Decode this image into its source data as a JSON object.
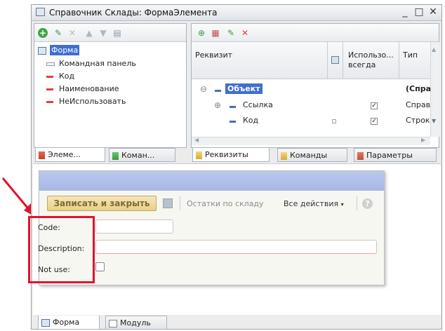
{
  "window": {
    "title": "Справочник Склады: ФормаЭлемента"
  },
  "left_panel": {
    "tree": [
      {
        "label": "Форма",
        "selected": true
      },
      {
        "label": "Командная панель"
      },
      {
        "label": "Код"
      },
      {
        "label": "Наименование"
      },
      {
        "label": "НеИспользовать"
      }
    ],
    "tabs": [
      "Элеме...",
      "Коман..."
    ]
  },
  "right_panel": {
    "columns": {
      "attr": "Реквизит",
      "always": "Использо... всегда",
      "type": "Тип"
    },
    "rows": [
      {
        "name": "Объект",
        "type": "(Спра",
        "checked": false,
        "expander": "⊖"
      },
      {
        "name": "Ссылка",
        "type": "Справ",
        "checked": true,
        "expander": "⊕"
      },
      {
        "name": "Код",
        "type": "Строк",
        "checked": true,
        "expander": ""
      }
    ],
    "tabs": [
      "Реквизиты",
      "Команды",
      "Параметры"
    ]
  },
  "preview": {
    "save_close": "Записать и закрыть",
    "stock_link": "Остатки по складу",
    "all_actions": "Все действия",
    "fields": [
      {
        "label": "Code:",
        "value": ""
      },
      {
        "label": "Description:",
        "value": ""
      },
      {
        "label": "Not use:",
        "checked": false
      }
    ]
  },
  "bottom_tabs": [
    "Форма",
    "Модуль"
  ],
  "colors": {
    "highlight": "#e4122a",
    "selection": "#3f6fd1",
    "toolbar_gold": "#e9cf86"
  }
}
